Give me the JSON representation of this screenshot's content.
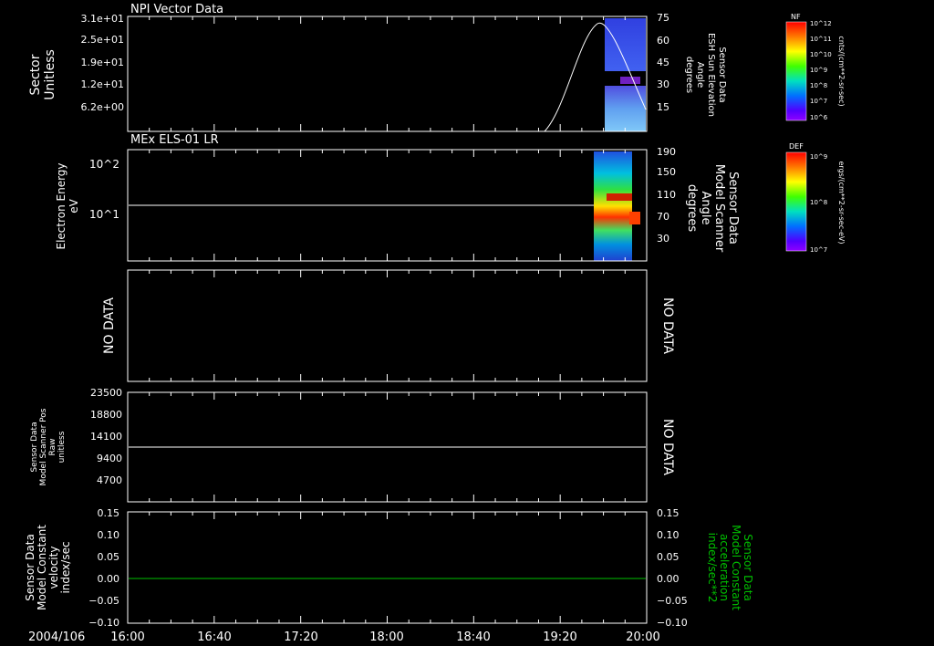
{
  "chart_data": [
    {
      "type": "spectrogram",
      "title": "NPI Vector Data",
      "ylabel": [
        "Sector",
        "Unitless"
      ],
      "yticks": [
        "3.1e+01",
        "2.5e+01",
        "1.9e+01",
        "1.2e+01",
        "6.2e+00"
      ],
      "right_ylabel": [
        "Sensor Data",
        "ESH Sun Elevation",
        "Angle",
        "degrees"
      ],
      "right_yticks": [
        75,
        60,
        45,
        30,
        15
      ],
      "right_ylim": [
        0,
        75
      ],
      "line_series": {
        "name": "ESH Sun Elevation Angle",
        "x": [
          "19:20",
          "19:30",
          "19:40",
          "19:50",
          "19:58",
          "20:00"
        ],
        "y": [
          0,
          25,
          62,
          70,
          30,
          18
        ]
      },
      "colorbar": {
        "label": "NF",
        "ticks": [
          "10^12",
          "10^11",
          "10^10",
          "10^9",
          "10^8",
          "10^7",
          "10^6"
        ],
        "unit": "cnts/(cm**2-sr-sec)"
      }
    },
    {
      "type": "spectrogram",
      "title": "MEx ELS-01 LR",
      "ylabel": [
        "Electron Energy",
        "eV"
      ],
      "yticks": [
        "10^2",
        "10^1"
      ],
      "right_ylabel": [
        "Sensor Data",
        "Model Scanner",
        "Angle",
        "degrees"
      ],
      "right_yticks": [
        190,
        150,
        110,
        70,
        30
      ],
      "right_ylim": [
        0,
        190
      ],
      "line_series": {
        "name": "Model Scanner Angle",
        "x": [
          "16:00",
          "19:10"
        ],
        "y": [
          95,
          95
        ]
      },
      "colorbar": {
        "label": "DEF",
        "ticks": [
          "10^9",
          "10^8",
          "10^7"
        ],
        "unit": "ergs/(cm**2-sr-sec-eV)"
      }
    },
    {
      "type": "line",
      "left_label": "NO DATA",
      "right_label": "NO DATA"
    },
    {
      "type": "line",
      "ylabel": [
        "Sensor Data",
        "Model Scanner Pos",
        "Raw",
        "unitless"
      ],
      "yticks": [
        23500,
        18800,
        14100,
        9400,
        4700
      ],
      "ylim": [
        0,
        23500
      ],
      "right_label": "NO DATA",
      "series": [
        {
          "x": [
            "16:00",
            "20:00"
          ],
          "values": [
            11750,
            11750
          ]
        }
      ]
    },
    {
      "type": "line",
      "ylabel": [
        "Sensor Data",
        "Model Constant",
        "velocity",
        "index/sec"
      ],
      "yticks": [
        "0.15",
        "0.10",
        "0.05",
        "0.00",
        "−0.05",
        "−0.10"
      ],
      "ylim": [
        -0.1,
        0.15
      ],
      "right_ylabel": [
        "Sensor Data",
        "Model Constant",
        "acceleration",
        "index/sec**2"
      ],
      "right_yticks": [
        "0.15",
        "0.10",
        "0.05",
        "0.00",
        "−0.05",
        "−0.10"
      ],
      "series": [
        {
          "x": [
            "16:00",
            "20:00"
          ],
          "values": [
            0.0,
            0.0
          ]
        }
      ]
    }
  ],
  "x_axis": {
    "date_label": "2004/106",
    "ticks": [
      "16:00",
      "16:40",
      "17:20",
      "18:00",
      "18:40",
      "19:20",
      "20:00"
    ]
  },
  "colors": {
    "background": "#000000",
    "frame": "#ffffff",
    "green_trace": "#00c000"
  }
}
